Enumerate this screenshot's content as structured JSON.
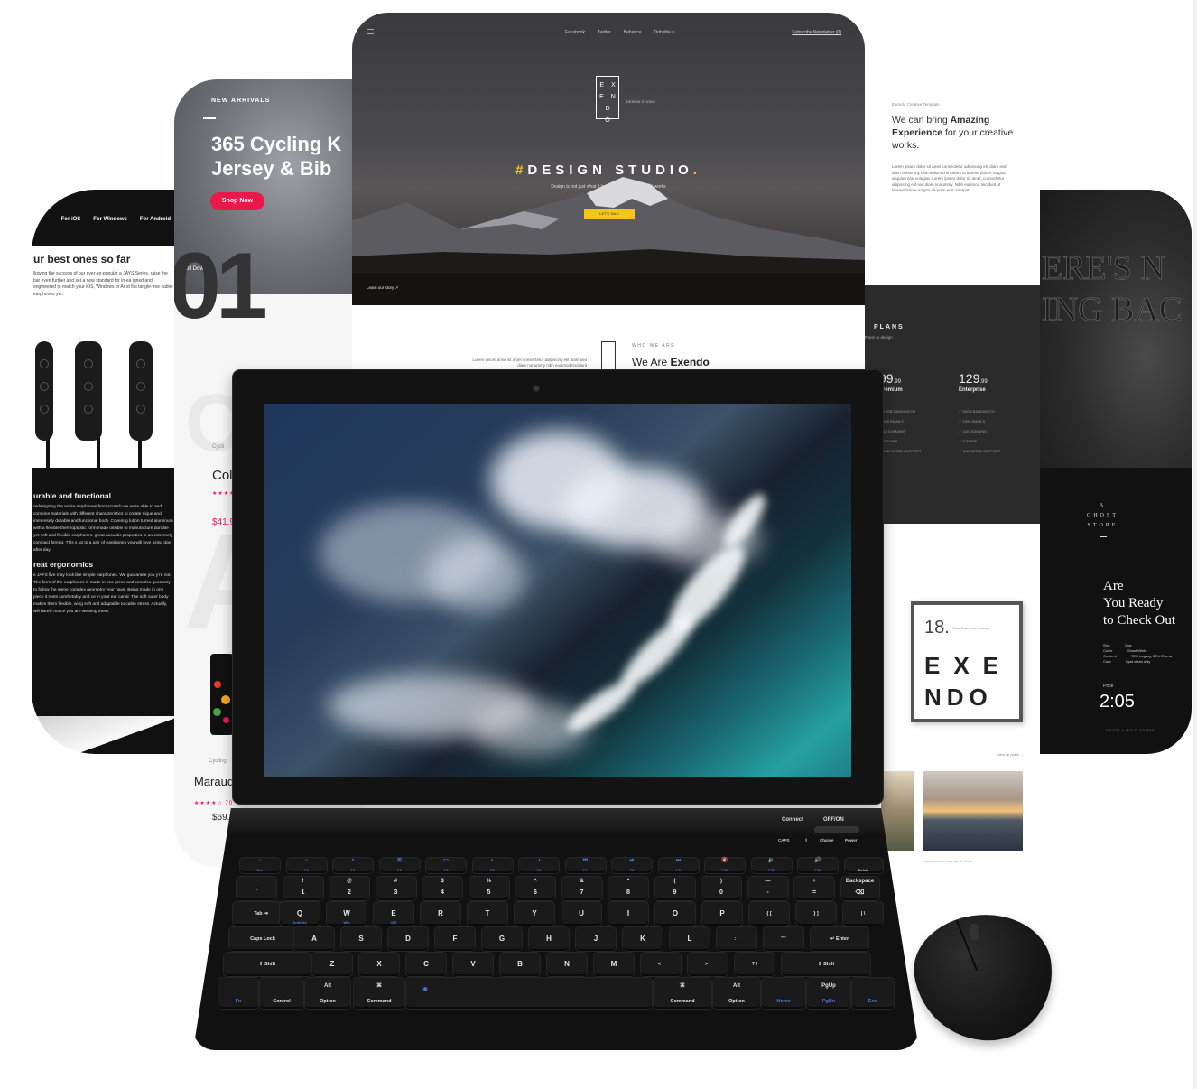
{
  "card_earphones": {
    "nav": [
      "For iOS",
      "For Windows",
      "For Android"
    ],
    "heading": "ur best ones so far",
    "para": "llowing the success of our ever-so-popular a JAYS Series, raise the bar even further and set a new standard for in-ea igned and engineered to match your iOS, Windows or Ar st flat tangle-free cable-earphones yet.",
    "dark_h1": "urable and functional",
    "dark_p1": "redesigning the entire earphones from scratch we were able to and combine materials with different characteristics to create nique and immensely durable and functional body. Covering lution turned aluminum with a flexible thermoplastic form made ossible to manufacture durable yet soft and flexible earphones. great acoustic properties in an extremely compact format. This s up to a pair of earphones you will love using day after day.",
    "dark_h2": "reat ergonomics",
    "dark_p2": "e JAYS five may look like simple earphones. We guarantee you y're not. The form of the earphones is made in one piece and complex geometry to follow the same complex geometry your have. Being made in one piece it rests comfortably and ce in your ear canal. The soft outer body makes them flexible, wing soft and adaptable to cable stress. Actually, will barely notice you are wearing them."
  },
  "card_cycling": {
    "tag": "NEW ARRIVALS",
    "title_line1": "365 Cycling K",
    "title_line2": "Jersey & Bib",
    "shop_label": "Shop Now",
    "scroll_label": "Scroll Down",
    "number": "01",
    "big_o": "C",
    "big_a": "A",
    "p1_cat": "Cycli",
    "p1_name": "Col",
    "p1_stars": "★★★★",
    "p1_price": "$41.9",
    "p2_cat": "Cycling",
    "p2_name": "Maraud",
    "p2_stars": "★★★★☆ 70",
    "p2_price": "$69.9"
  },
  "card_studio": {
    "nav": [
      "Facebook",
      "Twitter",
      "Behance",
      "Dribbble ▾"
    ],
    "subscribe": "Subscribe Newsletter (0)",
    "logo_letters": "E X E N D O",
    "logo_sub": "DESIGN STUDIO",
    "headline_prefix": "#",
    "headline": "DESIGN STUDIO",
    "headline_dot": ".",
    "tagline": "Design is not just what it looks like, design is how it works",
    "cta": "LET'S TALK",
    "below": "Learn our story ↗",
    "who": "WHO WE ARE",
    "weare": "We Are ",
    "weare_bold": "Exendo",
    "mini_text": "Lorem ipsum dolor sit amet consectetur adipiscing elit diam sed diam nonummy nibh euismod tincidunt"
  },
  "card_experience": {
    "label": "Exendo Creative Template",
    "h_pre": "We can bring ",
    "h_bold": "Amazing Experience",
    "h_post": " for your creative works.",
    "para": "Lorem ipsum dolor sit amet consectetur adipiscing elit diam sed diam nonummy nibh euismod tincidunt ut laoreet dolore magna aliquam erat volutpat. Lorem ipsum dolor sit amet, consectetur adipiscing elit sed diam nonummy. Nibh euismod tincidunt ut laoreet dolore magna aliquam erat volutpat.",
    "plans": "PLANS",
    "plans_sub": "Plans to design",
    "price1": "99",
    "price1_sup": ".99",
    "plan1": "Premium",
    "price2": "129",
    "price2_sup": ".99",
    "plan2": "Enterprise",
    "features1": [
      "✓ 10GB BANDWIDTH",
      "✓ 500 EMAILS",
      "✓ 10 DOMAINS",
      "✓ 3 STAFF",
      "✓ UNLIMITED SUPPORT"
    ],
    "features2": [
      "✓ 50GB BANDWIDTH",
      "✓ 1000 EMAILS",
      "✓ 100 DOMAINS",
      "✓ 8 STAFF",
      "✓ UNLIMITED SUPPORT"
    ]
  },
  "card_ghost": {
    "ghost_line1": "ERE'S N",
    "ghost_line2": "ING BAC",
    "store_line1": "A",
    "store_line2": "GHOST",
    "store_line3": "STORE",
    "ready_line1": "Are",
    "ready_line2": "You Ready",
    "ready_line3": "to Check Out",
    "spec_keys": [
      "Size",
      "Color",
      "Content",
      "Care"
    ],
    "spec_vals": [
      "One",
      "Ghost White",
      "70% Legacy, 30% Eterna",
      "Spot clean only"
    ],
    "price_label": "Price",
    "time": "2:05",
    "touch": "TOUCH & HOLD TO PAY"
  },
  "card_exendo18": {
    "number": "18.",
    "number_sub": "Years Experience in design",
    "line1": "EXE",
    "line2": "NDO",
    "view_all": "view all posts →",
    "caption": "Lorem ipsum, fuso, sono, lines"
  },
  "keyboard": {
    "connect": "Connect",
    "offon": "OFF/ON",
    "caps": "CAPS",
    "bt": "ᛒ",
    "charge": "Charge",
    "power": "Power",
    "fn_row": [
      {
        "top": "⌂",
        "sub": "Esc"
      },
      {
        "top": "☼",
        "sub": "F1"
      },
      {
        "top": "⌕",
        "sub": "F2"
      },
      {
        "top": "⊞",
        "sub": "F3"
      },
      {
        "top": "▭",
        "sub": "F4"
      },
      {
        "top": "◐",
        "sub": "F5"
      },
      {
        "top": "◑",
        "sub": "F6"
      },
      {
        "top": "⏮",
        "sub": "F7"
      },
      {
        "top": "⏯",
        "sub": "F8"
      },
      {
        "top": "⏭",
        "sub": "F9"
      },
      {
        "top": "🔇",
        "sub": "F10"
      },
      {
        "top": "🔉",
        "sub": "F11"
      },
      {
        "top": "🔊",
        "sub": "F12"
      },
      {
        "top": "",
        "sub": "Delete"
      }
    ],
    "num_row": [
      {
        "t": "~",
        "b": "`"
      },
      {
        "t": "!",
        "b": "1"
      },
      {
        "t": "@",
        "b": "2"
      },
      {
        "t": "#",
        "b": "3"
      },
      {
        "t": "$",
        "b": "4"
      },
      {
        "t": "%",
        "b": "5"
      },
      {
        "t": "^",
        "b": "6"
      },
      {
        "t": "&",
        "b": "7"
      },
      {
        "t": "*",
        "b": "8"
      },
      {
        "t": "(",
        "b": "9"
      },
      {
        "t": ")",
        "b": "0"
      },
      {
        "t": "—",
        "b": "-"
      },
      {
        "t": "+",
        "b": "="
      },
      {
        "t": "Backspace",
        "b": "⌫"
      }
    ],
    "q_row": [
      "Tab ⇥",
      "Q",
      "W",
      "E",
      "R",
      "T",
      "Y",
      "U",
      "I",
      "O",
      "P",
      "{ [",
      "} ]",
      "| \\"
    ],
    "q_subs": [
      "",
      "Android",
      "Win",
      "iOS"
    ],
    "a_row": [
      "Caps Lock",
      "A",
      "S",
      "D",
      "F",
      "G",
      "H",
      "J",
      "K",
      "L",
      ": ;",
      "\" '",
      "↵ Enter"
    ],
    "z_row": [
      "⇧ Shift",
      "Z",
      "X",
      "C",
      "V",
      "B",
      "N",
      "M",
      "< ,",
      "> .",
      "? /",
      "⇧ Shift"
    ],
    "bottom_row": [
      {
        "t": "",
        "b": "Fn"
      },
      {
        "t": "",
        "b": "Control"
      },
      {
        "t": "Alt",
        "b": "Option"
      },
      {
        "t": "⌘",
        "b": "Command"
      },
      {
        "t": "",
        "b": ""
      },
      {
        "t": "⌘",
        "b": "Command"
      },
      {
        "t": "Alt",
        "b": "Option"
      },
      {
        "t": "",
        "b": "Home"
      },
      {
        "t": "PgUp",
        "b": "PgDn"
      },
      {
        "t": "",
        "b": "End"
      }
    ]
  }
}
